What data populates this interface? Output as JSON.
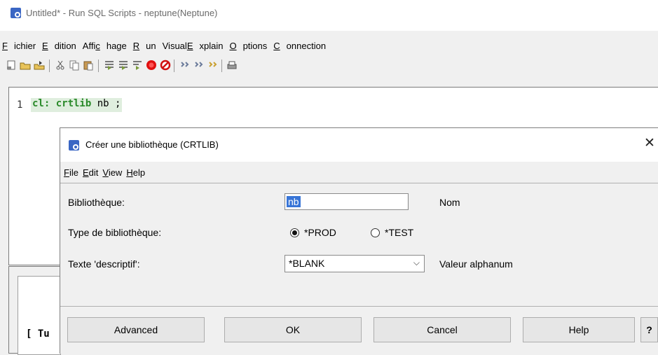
{
  "window": {
    "title": "Untitled* - Run SQL Scripts - neptune(Neptune)"
  },
  "menu": [
    {
      "label": "Fichier",
      "accel": "F"
    },
    {
      "label": "Edition",
      "accel": "E"
    },
    {
      "label": "Affichage",
      "accel": "f"
    },
    {
      "label": "Run",
      "accel": "R"
    },
    {
      "label": "VisualExplain",
      "accel": "E"
    },
    {
      "label": "Options",
      "accel": "O"
    },
    {
      "label": "Connection",
      "accel": "C"
    }
  ],
  "toolbar": {
    "icons": [
      "new-icon",
      "open-icon",
      "save-icon",
      "cut-icon",
      "copy-icon",
      "paste-icon",
      "run-all-icon",
      "run-from-selected-icon",
      "run-selected-icon",
      "stop-icon",
      "cancel-icon",
      "explain-icon",
      "run-explain-icon",
      "visual-explain-icon",
      "print-icon"
    ]
  },
  "editor": {
    "line_number": "1",
    "code_keyword": "cl: crtlib",
    "code_rest": " nb ;"
  },
  "lower_pane": {
    "partial_text": "[ Tu"
  },
  "dialog": {
    "title": "Créer une bibliothèque (CRTLIB)",
    "close": "✕",
    "menu": [
      "File",
      "Edit",
      "View",
      "Help"
    ],
    "fields": {
      "library_label": "Bibliothèque:",
      "library_value": "nb",
      "library_hint": "Nom",
      "type_label": "Type de bibliothèque:",
      "type_options": [
        "*PROD",
        "*TEST"
      ],
      "type_selected": "*PROD",
      "text_label": "Texte 'descriptif':",
      "text_value": "*BLANK",
      "text_hint": "Valeur alphanum"
    },
    "buttons": {
      "advanced": "Advanced",
      "ok": "OK",
      "cancel": "Cancel",
      "help": "Help",
      "question": "?"
    }
  }
}
